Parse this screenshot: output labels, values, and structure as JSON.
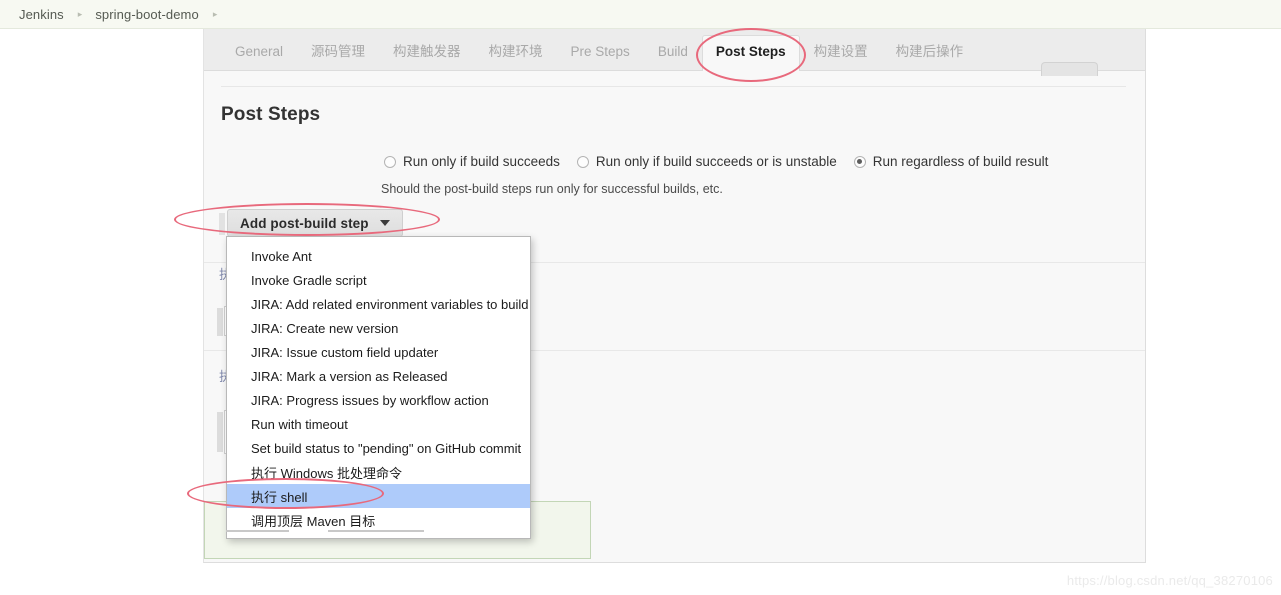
{
  "breadcrumb": {
    "items": [
      "Jenkins",
      "spring-boot-demo"
    ],
    "separator": "▸"
  },
  "tabs": [
    {
      "label": "General",
      "active": false
    },
    {
      "label": "源码管理",
      "active": false
    },
    {
      "label": "构建触发器",
      "active": false
    },
    {
      "label": "构建环境",
      "active": false
    },
    {
      "label": "Pre Steps",
      "active": false
    },
    {
      "label": "Build",
      "active": false
    },
    {
      "label": "Post Steps",
      "active": true
    },
    {
      "label": "构建设置",
      "active": false
    },
    {
      "label": "构建后操作",
      "active": false
    }
  ],
  "section": {
    "title": "Post Steps",
    "help_text": "Should the post-build steps run only for successful builds, etc.",
    "radios": [
      {
        "label": "Run only if build succeeds",
        "checked": false
      },
      {
        "label": "Run only if build succeeds or is unstable",
        "checked": false
      },
      {
        "label": "Run regardless of build result",
        "checked": true
      }
    ]
  },
  "add_button": {
    "label": "Add post-build step",
    "caret_icon": "chevron-down-icon"
  },
  "dropdown": {
    "items": [
      {
        "label": "Invoke Ant",
        "highlight": false
      },
      {
        "label": "Invoke Gradle script",
        "highlight": false
      },
      {
        "label": "JIRA: Add related environment variables to build",
        "highlight": false
      },
      {
        "label": "JIRA: Create new version",
        "highlight": false
      },
      {
        "label": "JIRA: Issue custom field updater",
        "highlight": false
      },
      {
        "label": "JIRA: Mark a version as Released",
        "highlight": false
      },
      {
        "label": "JIRA: Progress issues by workflow action",
        "highlight": false
      },
      {
        "label": "Run with timeout",
        "highlight": false
      },
      {
        "label": "Set build status to \"pending\" on GitHub commit",
        "highlight": false
      },
      {
        "label": "执行 Windows 批处理命令",
        "highlight": false
      },
      {
        "label": "执行 shell",
        "highlight": true
      },
      {
        "label": "调用顶层 Maven 目标",
        "highlight": false
      }
    ]
  },
  "annotations": [
    {
      "target": "post-steps-tab"
    },
    {
      "target": "add-post-build-step-button"
    },
    {
      "target": "execute-shell-menu-item"
    }
  ],
  "watermark": {
    "text": "https://blog.csdn.net/qq_38270106"
  },
  "colors": {
    "breadcrumb_bg": "#f7f9f2",
    "panel_bg": "#f8f8f8",
    "tabbar_bg": "#ececec",
    "menu_highlight": "#aecbfa",
    "annotation_red": "#e8697c",
    "save_bar_bg": "#f2f6ec",
    "save_bar_border": "#c3d6b6"
  }
}
